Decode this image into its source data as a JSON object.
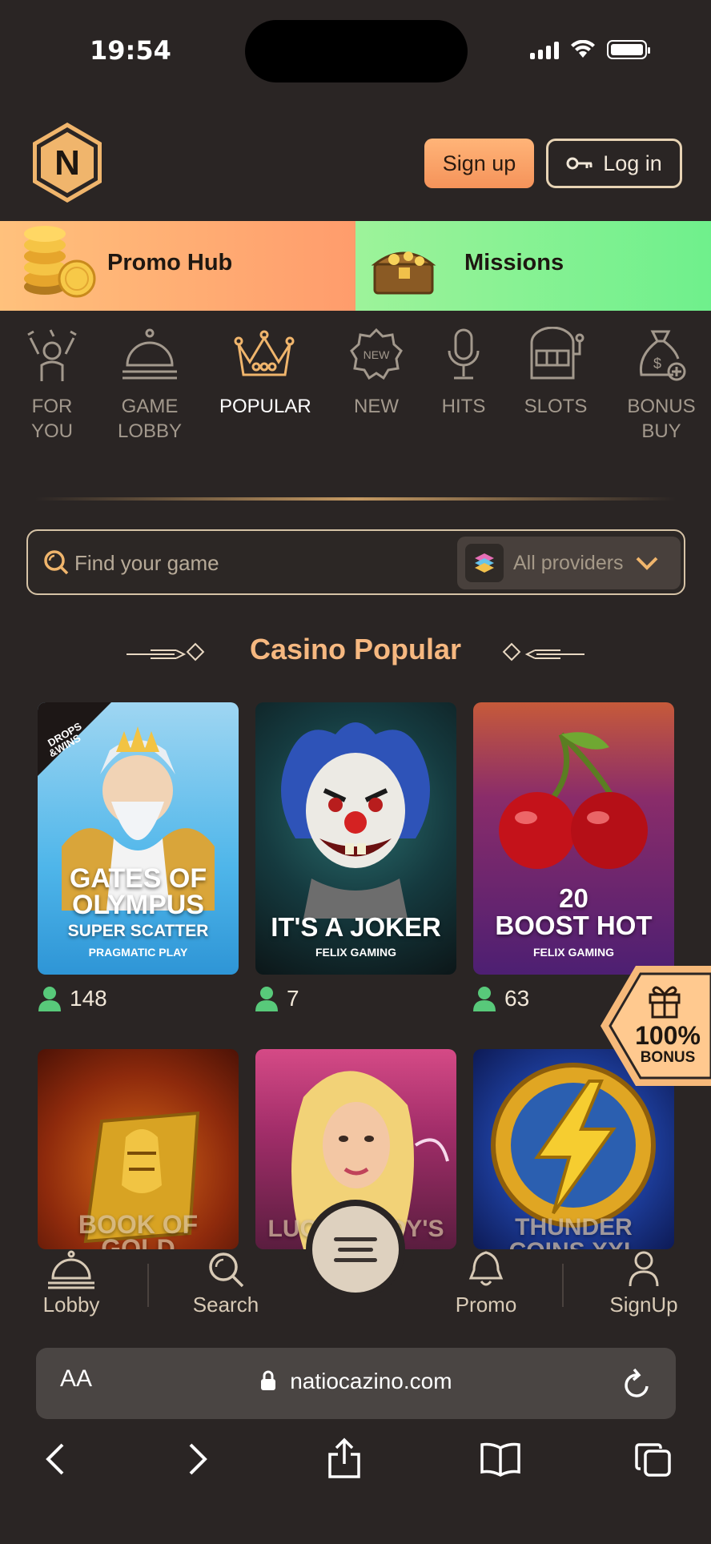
{
  "status_bar": {
    "time": "19:54"
  },
  "header": {
    "logo_letter": "N",
    "signup_label": "Sign up",
    "login_label": "Log in"
  },
  "promo": {
    "hub_label": "Promo Hub",
    "missions_label": "Missions"
  },
  "categories": [
    {
      "line1": "FOR",
      "line2": "YOU"
    },
    {
      "line1": "GAME",
      "line2": "LOBBY"
    },
    {
      "line1": "POPULAR",
      "line2": ""
    },
    {
      "line1": "NEW",
      "line2": ""
    },
    {
      "line1": "HITS",
      "line2": ""
    },
    {
      "line1": "SLOTS",
      "line2": ""
    },
    {
      "line1": "BONUS",
      "line2": "BUY"
    }
  ],
  "new_badge": "NEW",
  "search": {
    "placeholder": "Find your game",
    "providers_label": "All providers"
  },
  "section": {
    "title": "Casino Popular"
  },
  "games": [
    {
      "title_line1": "GATES OF",
      "title_line2": "OLYMPUS",
      "subtitle": "SUPER SCATTER",
      "provider": "PRAGMATIC PLAY",
      "players": "148",
      "badge_line1": "DROPS",
      "badge_line2": "&WINS"
    },
    {
      "title_line1": "IT'S A JOKER",
      "provider": "FELIX GAMING",
      "players": "7"
    },
    {
      "title_line1": "20",
      "title_line2": "BOOST HOT",
      "provider": "FELIX GAMING",
      "players": "63"
    },
    {
      "title_line1": "BOOK OF",
      "title_line2": "GOLD"
    },
    {
      "title_line1": "LUCKY LADY'S"
    },
    {
      "title_line1": "THUNDER",
      "title_line2": "COINS XXL"
    }
  ],
  "bonus": {
    "percent": "100%",
    "label": "BONUS"
  },
  "bottom_nav": {
    "lobby": "Lobby",
    "search": "Search",
    "promo": "Promo",
    "signup": "SignUp"
  },
  "browser": {
    "aa": "AA",
    "url": "natiocazino.com"
  },
  "colors": {
    "accent": "#f6b880",
    "signup_button": "#f5935a",
    "missions_green": "#7ff28f",
    "background": "#2a2524"
  }
}
